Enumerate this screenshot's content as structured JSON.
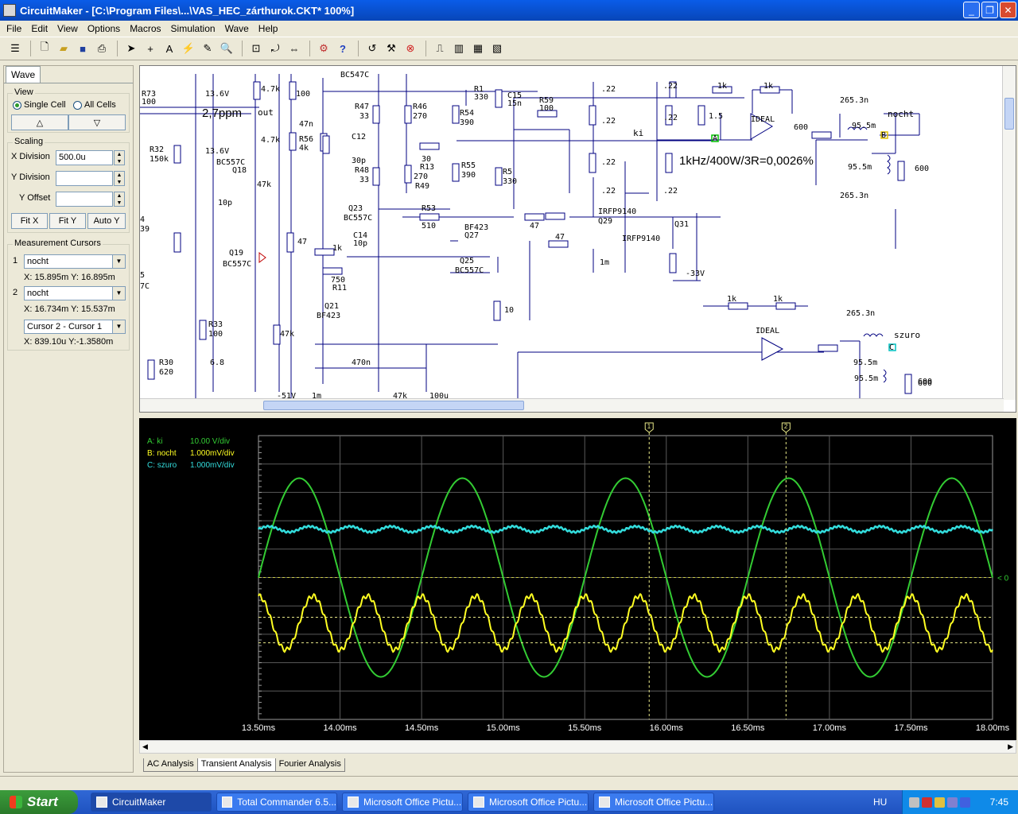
{
  "window": {
    "title": "CircuitMaker - [C:\\Program Files\\...\\VAS_HEC_zárthurok.CKT* 100%]",
    "minimize": "_",
    "maximize": "❐",
    "close": "✕"
  },
  "menu": [
    "File",
    "Edit",
    "View",
    "Options",
    "Macros",
    "Simulation",
    "Wave",
    "Help"
  ],
  "toolbar_icons": [
    "grid-icon",
    "new-file-icon",
    "open-file-icon",
    "save-icon",
    "print-icon",
    "arrow-tool-icon",
    "wire-tool-icon",
    "text-tool-icon",
    "probe-tool-icon",
    "pen-tool-icon",
    "zoom-icon",
    "fit-icon",
    "rotate-icon",
    "mirror-icon",
    "digital-icon",
    "help-icon",
    "reset-icon",
    "step-icon",
    "stop-icon",
    "wave-icon",
    "chart-icon",
    "chart2-icon",
    "chart3-icon"
  ],
  "panel": {
    "tab": "Wave",
    "view": {
      "title": "View",
      "single": "Single Cell",
      "all": "All Cells",
      "single_selected": true
    },
    "up": "△",
    "down": "▽",
    "scaling": {
      "title": "Scaling",
      "x_label": "X Division",
      "x_value": "500.0u",
      "y_label": "Y Division",
      "y_value": "",
      "offset_label": "Y Offset",
      "offset_value": "",
      "fitx": "Fit X",
      "fity": "Fit Y",
      "autoy": "Auto Y"
    },
    "cursors": {
      "title": "Measurement Cursors",
      "c1_num": "1",
      "c1_sel": "nocht",
      "c1_read": "X: 15.895m  Y: 16.895m",
      "c2_num": "2",
      "c2_sel": "nocht",
      "c2_read": "X: 16.734m  Y: 15.537m",
      "diff_sel": "Cursor 2 - Cursor 1",
      "diff_read": "X: 839.10u  Y:-1.3580m"
    }
  },
  "schematic": {
    "labels": [
      {
        "t": "R73"
      },
      {
        "t": "100"
      },
      {
        "t": "13.6V"
      },
      {
        "t": "2,7ppm"
      },
      {
        "t": "out"
      },
      {
        "t": "4.7k"
      },
      {
        "t": "100"
      },
      {
        "t": "47n"
      },
      {
        "t": "BC547C"
      },
      {
        "t": "R47"
      },
      {
        "t": "33"
      },
      {
        "t": "R46"
      },
      {
        "t": "270"
      },
      {
        "t": "R54"
      },
      {
        "t": "390"
      },
      {
        "t": "R1"
      },
      {
        "t": "330"
      },
      {
        "t": "C15"
      },
      {
        "t": "15n"
      },
      {
        "t": "R59"
      },
      {
        "t": "100"
      },
      {
        "t": ".22"
      },
      {
        "t": ".22"
      },
      {
        "t": "1k"
      },
      {
        "t": "1k"
      },
      {
        "t": "R32"
      },
      {
        "t": "150k"
      },
      {
        "t": "13.6V"
      },
      {
        "t": "4.7k"
      },
      {
        "t": "BC557C"
      },
      {
        "t": "Q18"
      },
      {
        "t": "47k"
      },
      {
        "t": "R56"
      },
      {
        "t": "4k"
      },
      {
        "t": "C12"
      },
      {
        "t": "30p"
      },
      {
        "t": "30"
      },
      {
        "t": "R13"
      },
      {
        "t": "270"
      },
      {
        "t": "R55"
      },
      {
        "t": "390"
      },
      {
        "t": "R48"
      },
      {
        "t": "33"
      },
      {
        "t": "R49"
      },
      {
        "t": ".22"
      },
      {
        "t": "ki"
      },
      {
        "t": ".22"
      },
      {
        "t": "1.5"
      },
      {
        "t": "IDEAL"
      },
      {
        "t": "600"
      },
      {
        "t": "265.3n"
      },
      {
        "t": "95.5m"
      },
      {
        "t": "nocht"
      },
      {
        "t": "1kHz/400W/3R=0,0026%"
      },
      {
        "t": ".22"
      },
      {
        "t": "95.5m"
      },
      {
        "t": "600"
      },
      {
        "t": ".22"
      },
      {
        "t": ".22"
      },
      {
        "t": "R5"
      },
      {
        "t": "330"
      },
      {
        "t": "10p"
      },
      {
        "t": "Q23"
      },
      {
        "t": "BC557C"
      },
      {
        "t": "R53"
      },
      {
        "t": "510"
      },
      {
        "t": "IRFP9140"
      },
      {
        "t": "Q29"
      },
      {
        "t": "Q31"
      },
      {
        "t": "IRFP9140"
      },
      {
        "t": "265.3n"
      },
      {
        "t": "47"
      },
      {
        "t": "47"
      },
      {
        "t": "BF423"
      },
      {
        "t": "Q27"
      },
      {
        "t": "Q19"
      },
      {
        "t": "BC557C"
      },
      {
        "t": "47"
      },
      {
        "t": "1k"
      },
      {
        "t": "C14"
      },
      {
        "t": "10p"
      },
      {
        "t": "Q25"
      },
      {
        "t": "BC557C"
      },
      {
        "t": "1m"
      },
      {
        "t": "-33V"
      },
      {
        "t": "750"
      },
      {
        "t": "R11"
      },
      {
        "t": "Q21"
      },
      {
        "t": "BF423"
      },
      {
        "t": "1k"
      },
      {
        "t": "1k"
      },
      {
        "t": "10"
      },
      {
        "t": "IDEAL"
      },
      {
        "t": "265.3n"
      },
      {
        "t": "R33"
      },
      {
        "t": "100"
      },
      {
        "t": "47k"
      },
      {
        "t": "95.5m"
      },
      {
        "t": "szuro"
      },
      {
        "t": "600"
      },
      {
        "t": "R30"
      },
      {
        "t": "620"
      },
      {
        "t": "6.8"
      },
      {
        "t": "470n"
      },
      {
        "t": "95.5m"
      },
      {
        "t": "600"
      },
      {
        "t": "-51V"
      },
      {
        "t": "1m"
      },
      {
        "t": "47k"
      },
      {
        "t": "100u"
      },
      {
        "t": "4"
      },
      {
        "t": "39"
      },
      {
        "t": "5"
      },
      {
        "t": "7C"
      },
      {
        "t": "A"
      },
      {
        "t": "B"
      },
      {
        "t": "C"
      }
    ]
  },
  "scope": {
    "legend": [
      {
        "name": "A: ki",
        "scale": "10.00 V/div",
        "color": "#33cc33"
      },
      {
        "name": "B: nocht",
        "scale": "1.000mV/div",
        "color": "#ffff22"
      },
      {
        "name": "C: szuro",
        "scale": "1.000mV/div",
        "color": "#33dddd"
      }
    ],
    "cursor1_label": "1",
    "cursor2_label": "2",
    "zero_marker": "0"
  },
  "chart_data": {
    "type": "line",
    "x_ticks": [
      "13.50ms",
      "14.00ms",
      "14.50ms",
      "15.00ms",
      "15.50ms",
      "16.00ms",
      "16.50ms",
      "17.00ms",
      "17.50ms",
      "18.00ms"
    ],
    "xlim": [
      13.5,
      18.0
    ],
    "x_unit": "ms",
    "grid": true,
    "cursors": [
      15.895,
      16.734
    ],
    "series": [
      {
        "name": "A: ki",
        "kind": "sine",
        "frequency_hz": 1000,
        "amplitude_div": 3.5,
        "phase_peak_ms": 13.75,
        "offset_div": 0
      },
      {
        "name": "B: nocht",
        "kind": "sine",
        "frequency_hz": 3000,
        "amplitude_div": 1.0,
        "offset_div": -1.6
      },
      {
        "name": "C: szuro",
        "kind": "sine",
        "frequency_hz": 1000,
        "amplitude_div": 0.1,
        "offset_div": 1.7
      }
    ]
  },
  "tabs": [
    "AC Analysis",
    "Transient Analysis",
    "Fourier Analysis"
  ],
  "taskbar": {
    "start": "Start",
    "tasks": [
      "CircuitMaker",
      "Total Commander 6.5...",
      "Microsoft Office Pictu...",
      "Microsoft Office Pictu...",
      "Microsoft Office Pictu..."
    ],
    "lang": "HU",
    "clock": "7:45"
  }
}
